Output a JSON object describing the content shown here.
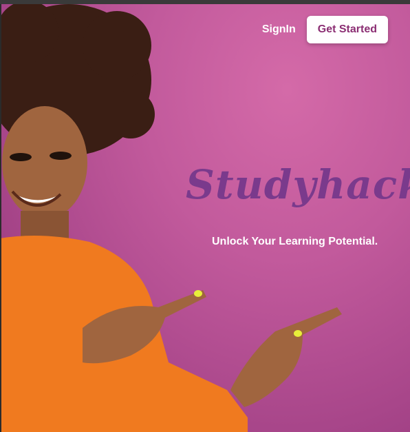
{
  "nav": {
    "signin_label": "SignIn",
    "cta_label": "Get Started"
  },
  "hero": {
    "brand": "Studyhacks",
    "tagline": "Unlock Your Learning Potential."
  },
  "colors": {
    "background": "#c25a9c",
    "brand": "#7a3a8c",
    "cta_text": "#8b2e73",
    "shirt": "#f07a1f"
  }
}
